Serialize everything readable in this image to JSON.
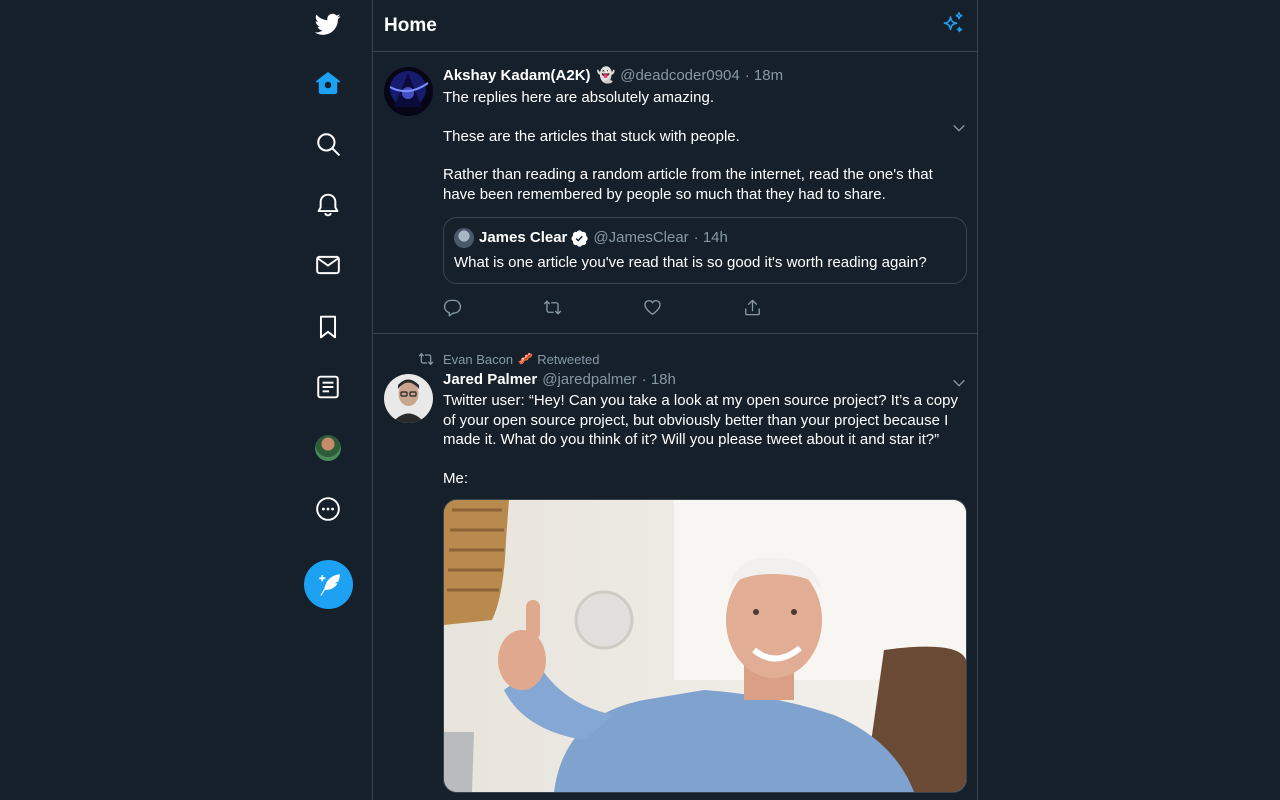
{
  "nav": {
    "icons": [
      "twitter-logo-icon",
      "home-icon",
      "explore-icon",
      "notifications-icon",
      "messages-icon",
      "bookmarks-icon",
      "lists-icon",
      "profile-avatar",
      "more-icon"
    ],
    "compose_icon": "compose-tweet-icon",
    "accent": "#1da1f2"
  },
  "header": {
    "title": "Home",
    "icon": "sparkle-icon"
  },
  "tweets": [
    {
      "name": "Akshay Kadam(A2K)",
      "emoji": "👻",
      "handle": "@deadcoder0904",
      "time": "· 18m",
      "paragraphs": [
        "The replies here are absolutely amazing.",
        "These are the articles that stuck with people.",
        "Rather than reading a random article from the internet, read the one's that have been remembered by people so much that they had to share."
      ],
      "quote": {
        "name": "James Clear",
        "handle": "@JamesClear",
        "time": "· 14h",
        "text": "What is one article you've read that is so good it's worth reading again?"
      }
    },
    {
      "retweeted_by": "Evan Bacon",
      "retweeted_emoji": "🥓",
      "retweeted_label": "Retweeted",
      "name": "Jared Palmer",
      "handle": "@jaredpalmer",
      "time": "· 18h",
      "paragraphs": [
        "Twitter user: “Hey! Can you take a look at my open source project? It’s a copy of your open source project, but obviously better than your project because I made it. What do you think of it? Will you please tweet about it and star it?”",
        "Me:"
      ]
    }
  ],
  "colors": {
    "background": "#15202b",
    "border": "#38444d",
    "muted": "#8899a6",
    "text": "#ffffff"
  }
}
